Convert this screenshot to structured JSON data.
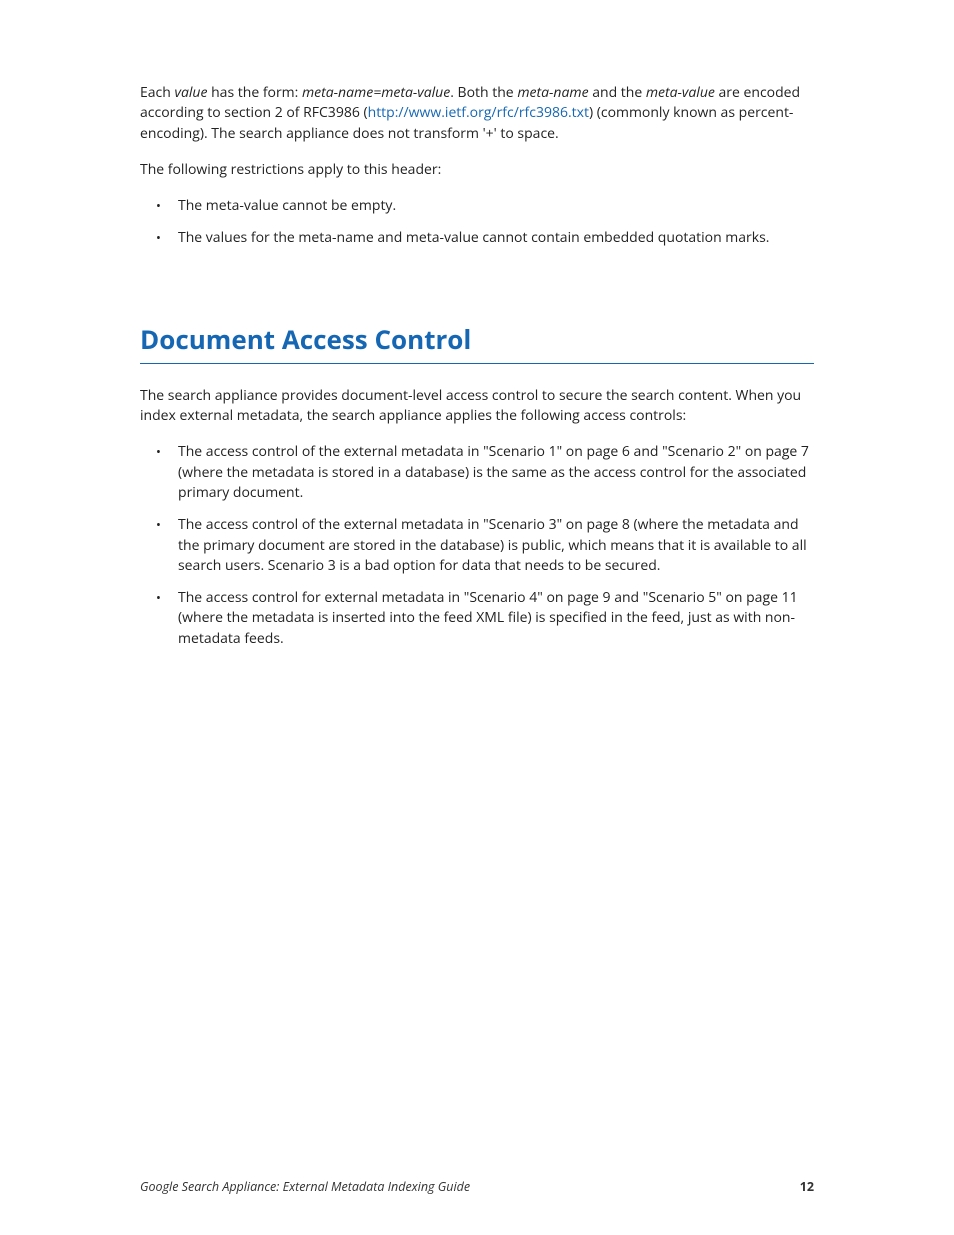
{
  "intro": {
    "p1_a": "Each ",
    "p1_value": "value",
    "p1_b": " has the form: ",
    "p1_form": "meta-name=meta-value",
    "p1_c": ". Both the ",
    "p1_mname": "meta-name",
    "p1_d": " and the ",
    "p1_mvalue": "meta-value",
    "p1_e": " are encoded according to section 2 of RFC3986 (",
    "p1_link": "http://www.ietf.org/rfc/rfc3986.txt",
    "p1_f": ") (commonly known as percent-encoding). The search appliance does not transform '+' to space.",
    "p2": "The following restrictions apply to this header:",
    "b1": "The meta-value cannot be empty.",
    "b2": "The values for the meta-name and meta-value cannot contain embedded quotation marks."
  },
  "section": {
    "heading": "Document Access Control",
    "p1": "The search appliance provides document-level access control to secure the search content. When you index external metadata, the search appliance applies the following access controls:",
    "b1": "The access control of the external metadata in \"Scenario 1\" on page 6 and \"Scenario 2\" on page 7 (where the metadata is stored in a database) is the same as the access control for the associated primary document.",
    "b2": "The access control of the external metadata in \"Scenario 3\" on page 8 (where the metadata and the primary document are stored in the database) is public, which means that it is available to all search users. Scenario 3 is a bad option for data that needs to be secured.",
    "b3": "The access control for external metadata in \"Scenario 4\" on page 9 and \"Scenario 5\" on page 11 (where the metadata is inserted into the feed XML file) is specified in the feed, just as with non-metadata feeds."
  },
  "footer": {
    "title": "Google Search Appliance: External Metadata Indexing Guide",
    "page": "12"
  }
}
